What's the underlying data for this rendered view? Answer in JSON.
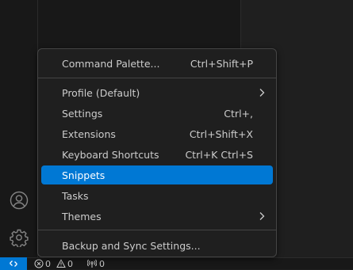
{
  "menu": {
    "items": [
      {
        "label": "Command Palette...",
        "shortcut": "Ctrl+Shift+P"
      },
      {
        "label": "Profile (Default)",
        "shortcut": ""
      },
      {
        "label": "Settings",
        "shortcut": "Ctrl+,"
      },
      {
        "label": "Extensions",
        "shortcut": "Ctrl+Shift+X"
      },
      {
        "label": "Keyboard Shortcuts",
        "shortcut": "Ctrl+K Ctrl+S"
      },
      {
        "label": "Snippets",
        "shortcut": ""
      },
      {
        "label": "Tasks",
        "shortcut": ""
      },
      {
        "label": "Themes",
        "shortcut": ""
      },
      {
        "label": "Backup and Sync Settings...",
        "shortcut": ""
      }
    ],
    "active_item": "Snippets",
    "submenu_items": [
      "Profile (Default)",
      "Themes"
    ]
  },
  "activity_bar": {
    "icons": [
      "accounts-icon",
      "gear-icon"
    ]
  },
  "status_bar": {
    "remote_icon": "remote-icon",
    "errors": "0",
    "warnings": "0",
    "ports": "0"
  },
  "colors": {
    "accent": "#0078d4",
    "menu_background": "#1f1f1f",
    "menu_border": "#454545",
    "text": "#cccccc"
  }
}
